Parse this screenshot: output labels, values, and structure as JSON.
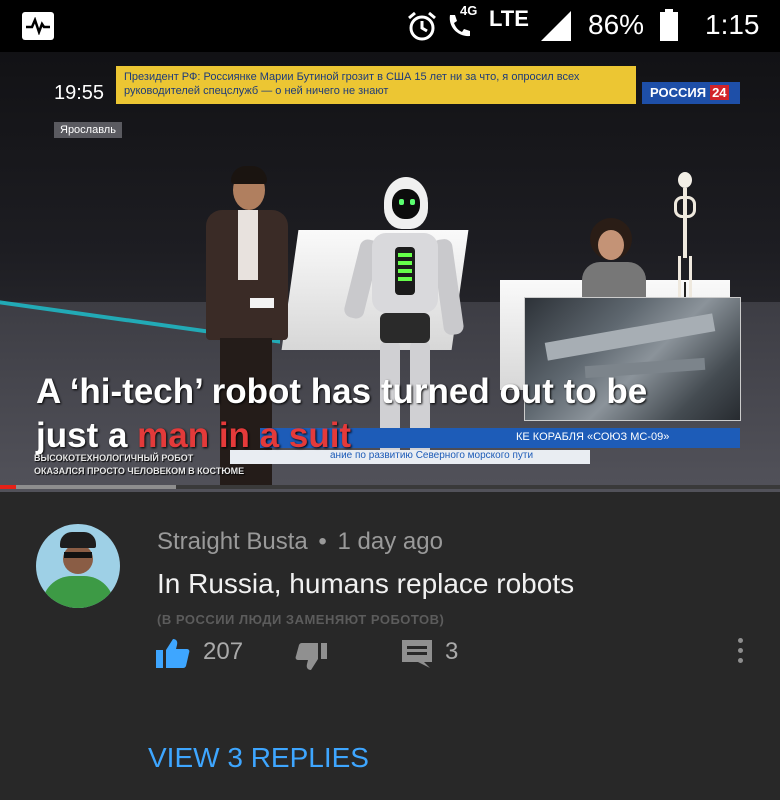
{
  "status_bar": {
    "network_type": "4G",
    "lte_label": "LTE",
    "battery_percent": "86%",
    "time": "1:15",
    "icons": [
      "app-monitor-icon",
      "alarm-clock-icon",
      "wifi-calling-icon",
      "signal-strength-icon",
      "battery-icon"
    ]
  },
  "video": {
    "broadcast_time": "19:55",
    "ticker_text": "Президент РФ: Россиянке Марии Бутиной грозит в США 15 лет ни за что, я опросил всех руководителей спецслужб — о ней ничего не знают",
    "channel_name": "РОССИЯ",
    "channel_number": "24",
    "city_label": "Ярославль",
    "caption_part1": "A ‘hi-tech’ robot has turned out to be just a ",
    "caption_highlight": "man in a suit",
    "subcaption_line1": "ВЫСОКОТЕХНОЛОГИЧНЫЙ РОБОТ",
    "subcaption_line2": "ОКАЗАЛСЯ ПРОСТО ЧЕЛОВЕКОМ В КОСТЮМЕ",
    "lower_bar_text": "КЕ КОРАБЛЯ «СОЮЗ МС-09»",
    "lower_strip_text": "ание по развитию Северного морского пути",
    "progress_played_fraction": 0.02,
    "progress_buffered_fraction": 0.225,
    "highlight_color": "#e43a3a"
  },
  "comment": {
    "author": "Straight Busta",
    "separator": "•",
    "time_ago": "1 day ago",
    "text": "In Russia, humans replace robots",
    "translation": "(В РОССИИ ЛЮДИ ЗАМЕНЯЮТ РОБОТОВ)",
    "like_count": "207",
    "reply_count": "3",
    "accent_color": "#3ea6ff"
  },
  "view_replies_label": "VIEW 3 REPLIES"
}
